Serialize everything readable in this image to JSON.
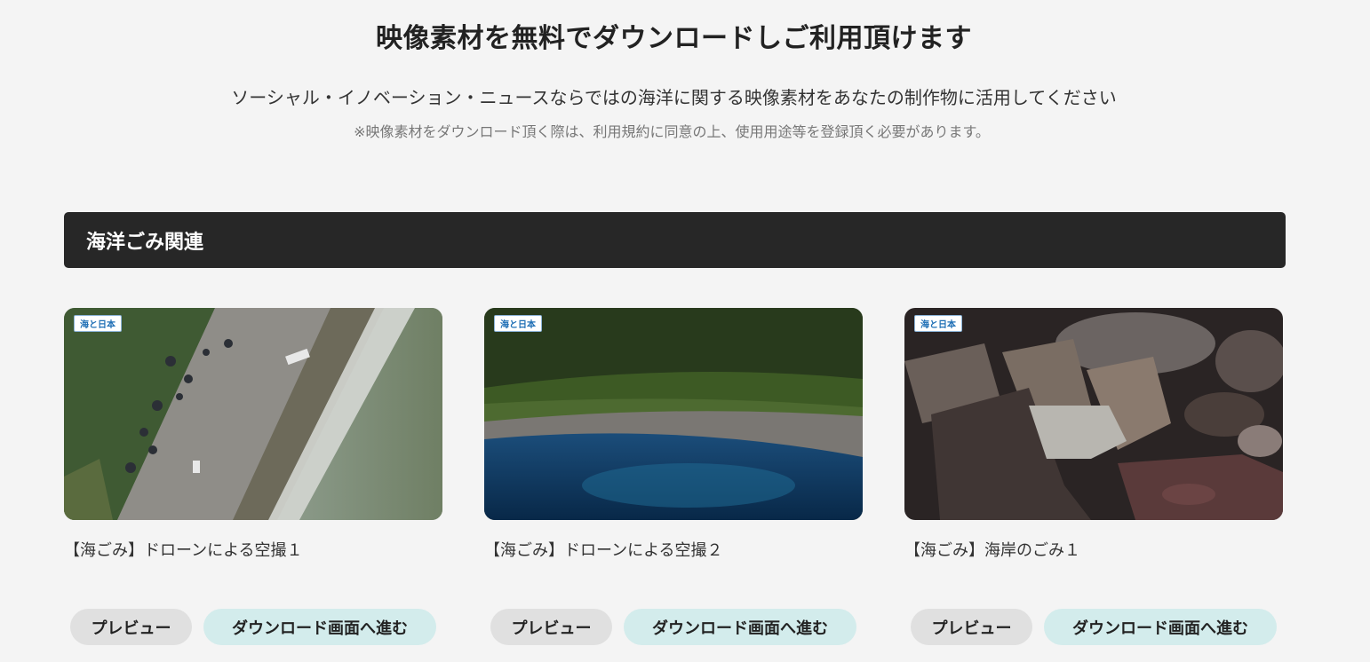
{
  "header": {
    "title": "映像素材を無料でダウンロードしご利用頂けます",
    "lead": "ソーシャル・イノベーション・ニュースならではの海洋に関する映像素材をあなたの制作物に活用してください",
    "note": "※映像素材をダウンロード頂く際は、利用規約に同意の上、使用用途等を登録頂く必要があります。"
  },
  "category": {
    "title": "海洋ごみ関連"
  },
  "cards": [
    {
      "title": "【海ごみ】ドローンによる空撮１",
      "preview_label": "プレビュー",
      "download_label": "ダウンロード画面へ進む"
    },
    {
      "title": "【海ごみ】ドローンによる空撮２",
      "preview_label": "プレビュー",
      "download_label": "ダウンロード画面へ進む"
    },
    {
      "title": "【海ごみ】海岸のごみ１",
      "preview_label": "プレビュー",
      "download_label": "ダウンロード画面へ進む"
    }
  ],
  "logo_text": "海と日本",
  "colors": {
    "category_bar": "#272727",
    "preview_button": "#e0e0e0",
    "download_button": "#d3ecec",
    "background": "#f4f4f4"
  }
}
